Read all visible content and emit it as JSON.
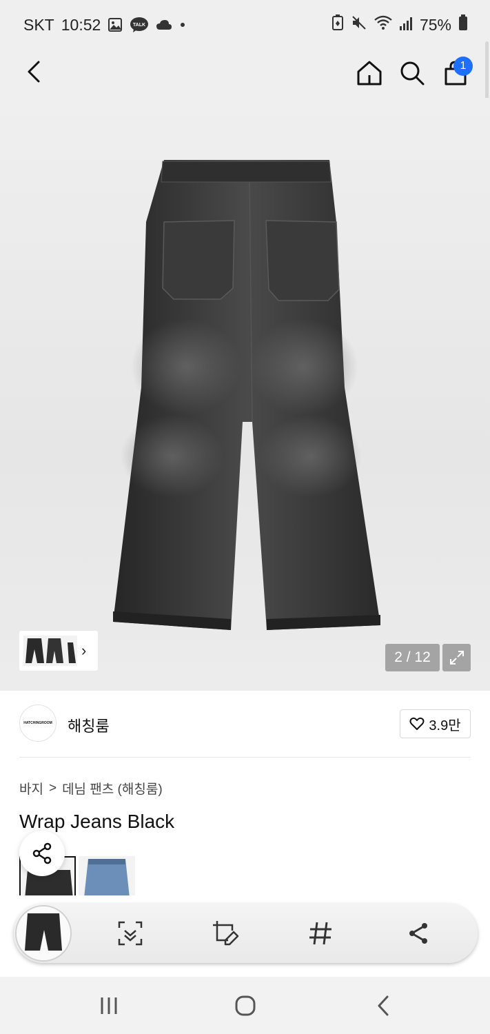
{
  "status_bar": {
    "carrier": "SKT",
    "time": "10:52",
    "battery": "75%",
    "talk_label": "TALK",
    "icons": [
      "gallery-icon",
      "kakaotalk-icon",
      "cloud-icon",
      "dot-icon",
      "battery-saver-icon",
      "mute-icon",
      "wifi-icon",
      "signal-icon",
      "battery-icon"
    ]
  },
  "header": {
    "cart_count": "1",
    "icons": [
      "back-icon",
      "home-icon",
      "search-icon",
      "cart-icon"
    ]
  },
  "gallery": {
    "counter": "2 / 12",
    "thumb_chevron": "›"
  },
  "brand": {
    "logo_text": "HATCHINGROOM",
    "name": "해칭룸",
    "likes": "3.9만"
  },
  "product": {
    "breadcrumb": [
      "바지",
      "데님 팬츠 (해칭룸)"
    ],
    "breadcrumb_sep": ">",
    "title": "Wrap Jeans Black",
    "color_options": [
      "black",
      "blue"
    ]
  },
  "capture_toolbar": {
    "icons": [
      "scan-text-icon",
      "edit-capture-icon",
      "hashtag-icon",
      "share-icon"
    ]
  },
  "nav_bar": {
    "icons": [
      "recent-apps-icon",
      "home-circle-icon",
      "back-nav-icon"
    ]
  },
  "colors": {
    "badge_blue": "#1f6fff",
    "denim_black": "#2b2b2b",
    "denim_blue": "#6b8fb8"
  }
}
